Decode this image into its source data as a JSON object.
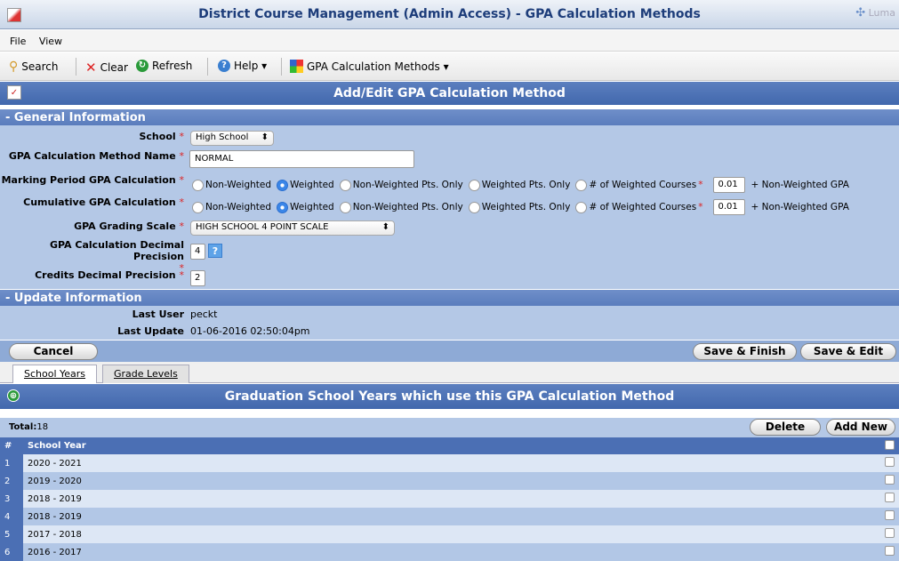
{
  "window": {
    "title": "District Course Management (Admin Access) - GPA Calculation Methods",
    "logo_text": "Luma"
  },
  "menu": {
    "file": "File",
    "view": "View"
  },
  "toolbar": {
    "search": "Search",
    "clear": "Clear",
    "refresh": "Refresh",
    "help": "Help ▾",
    "gpa_methods": "GPA Calculation Methods ▾"
  },
  "panel": {
    "title": "Add/Edit GPA Calculation Method"
  },
  "general": {
    "header": "- General Information",
    "school_label": "School",
    "school_value": "High School",
    "method_name_label": "GPA Calculation Method Name",
    "method_name_value": "NORMAL",
    "mp_label": "Marking Period GPA Calculation",
    "cum_label": "Cumulative GPA Calculation",
    "opt_non_weighted": "Non-Weighted",
    "opt_weighted": "Weighted",
    "opt_nw_pts": "Non-Weighted Pts. Only",
    "opt_w_pts": "Weighted Pts. Only",
    "opt_num_weighted": "# of Weighted Courses",
    "mp_weighted_courses": "0.01",
    "cum_weighted_courses": "0.01",
    "plus_nonweighted": "+ Non-Weighted GPA",
    "grading_scale_label": "GPA Grading Scale",
    "grading_scale_value": "HIGH SCHOOL 4 POINT SCALE",
    "decimal_precision_label": "GPA Calculation Decimal Precision",
    "decimal_precision_value": "4",
    "credits_precision_label": "Credits Decimal Precision",
    "credits_precision_value": "2",
    "required_mark": "*"
  },
  "update": {
    "header": "- Update Information",
    "last_user_label": "Last User",
    "last_user_value": "peckt",
    "last_update_label": "Last Update",
    "last_update_value": "01-06-2016 02:50:04pm"
  },
  "actions": {
    "cancel": "Cancel",
    "save_finish": "Save & Finish",
    "save_edit": "Save & Edit"
  },
  "tabs": [
    {
      "label": "School Years"
    },
    {
      "label": "Grade Levels"
    }
  ],
  "grid": {
    "title": "Graduation School Years which use this GPA Calculation Method",
    "total_label": "Total:",
    "total_value": "18",
    "delete": "Delete",
    "add_new": "Add New",
    "col_num": "#",
    "col_year": "School Year",
    "rows": [
      {
        "n": "1",
        "year": "2020 - 2021"
      },
      {
        "n": "2",
        "year": "2019 - 2020"
      },
      {
        "n": "3",
        "year": "2018 - 2019"
      },
      {
        "n": "4",
        "year": "2018 - 2019"
      },
      {
        "n": "5",
        "year": "2017 - 2018"
      },
      {
        "n": "6",
        "year": "2016 - 2017"
      }
    ]
  }
}
